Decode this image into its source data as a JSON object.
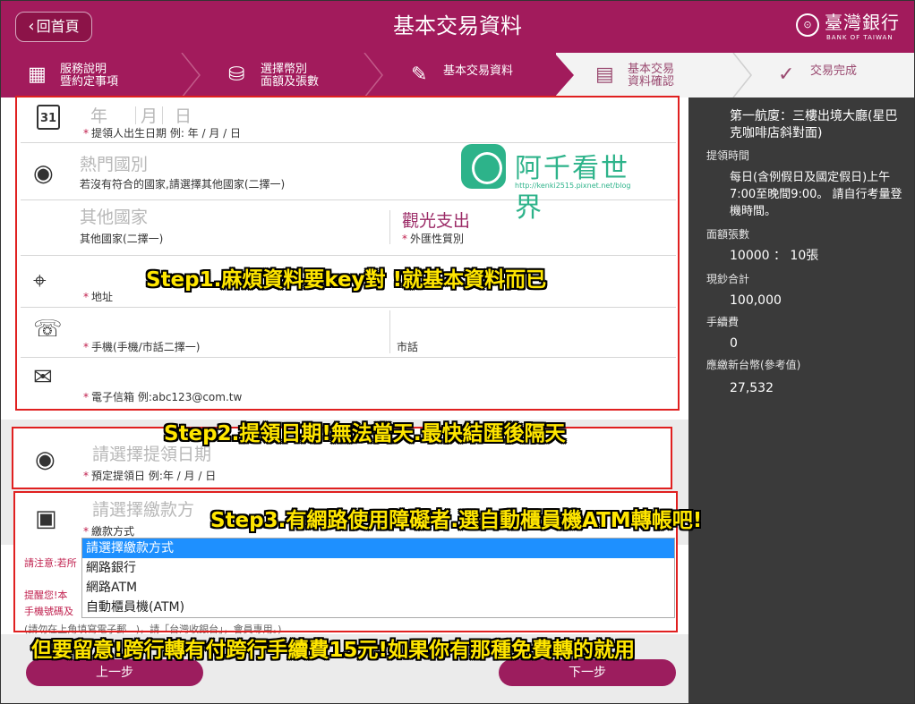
{
  "header": {
    "back_label": "回首頁",
    "title": "基本交易資料",
    "bank_name": "臺灣銀行",
    "bank_name_en": "BANK OF TAIWAN"
  },
  "steps": [
    {
      "line1": "服務說明",
      "line2": "暨約定事項",
      "state": "done"
    },
    {
      "line1": "選擇幣別",
      "line2": "面額及張數",
      "state": "done"
    },
    {
      "line1": "基本交易資料",
      "line2": "",
      "state": "current"
    },
    {
      "line1": "基本交易",
      "line2": "資料確認",
      "state": "todo"
    },
    {
      "line1": "交易完成",
      "line2": "",
      "state": "todo"
    }
  ],
  "form": {
    "birth": {
      "year_ph": "年",
      "month_ph": "月",
      "day_ph": "日",
      "label": "提領人出生日期 例: 年 / 月 / 日",
      "calendar_num": "31"
    },
    "country": {
      "placeholder": "熱門國別",
      "label": "若沒有符合的國家,請選擇其他國家(二擇一)"
    },
    "other_country": {
      "placeholder": "其他國家",
      "label": "其他國家(二擇一)"
    },
    "fx_type": {
      "value": "觀光支出",
      "label": "外匯性質別"
    },
    "address": {
      "label": "地址"
    },
    "mobile": {
      "label": "手機(手機/市話二擇一)",
      "phone_label": "市話"
    },
    "email": {
      "label": "電子信箱 例:abc123@com.tw"
    },
    "pickup_date": {
      "placeholder": "請選擇提領日期",
      "label": "預定提領日 例:年 / 月 / 日"
    },
    "payment": {
      "placeholder": "請選擇繳款方",
      "label": "繳款方式",
      "options": [
        "請選擇繳款方式",
        "網路銀行",
        "網路ATM",
        "自動櫃員機(ATM)"
      ],
      "selected_index": 0
    },
    "notes": {
      "n1": "請注意:若所",
      "n2": "提醒您!本",
      "n3": "手機號碼及",
      "n4": "(請勿在上角填寫電子郵...)，請「台灣收銀台」，會員專用。)"
    }
  },
  "buttons": {
    "prev": "上一步",
    "next": "下一步"
  },
  "sidebar": {
    "location": "第一航廈：三樓出境大廳(星巴克咖啡店斜對面)",
    "pickup_time_label": "提領時間",
    "pickup_time_value": "每日(含例假日及國定假日)上午7:00至晚間9:00。 請自行考量登機時間。",
    "denomination_label": "面額張數",
    "denomination_value": "10000 ： 10張",
    "total_label": "現鈔合計",
    "total_value": "100,000",
    "fee_label": "手續費",
    "fee_value": "0",
    "ntd_label": "應繳新台幣(參考值)",
    "ntd_value": "27,532"
  },
  "annotations": {
    "step1": "Step1.麻煩資料要key對 !就基本資料而已",
    "step2": "Step2.提領日期!無法當天.最快結匯後隔天",
    "step3": "Step3.有網路使用障礙者.選自動櫃員機ATM轉帳吧!",
    "bottom": "但要留意!跨行轉有付跨行手續費15元!如果你有那種免費轉的就用"
  },
  "watermark": {
    "name": "阿千看世界",
    "url": "http://kenki2515.pixnet.net/blog"
  },
  "colors": {
    "brand": "#a21b5c",
    "annotation_text": "#ffe600",
    "highlight_box": "#e02020",
    "selection": "#1e90ff"
  }
}
